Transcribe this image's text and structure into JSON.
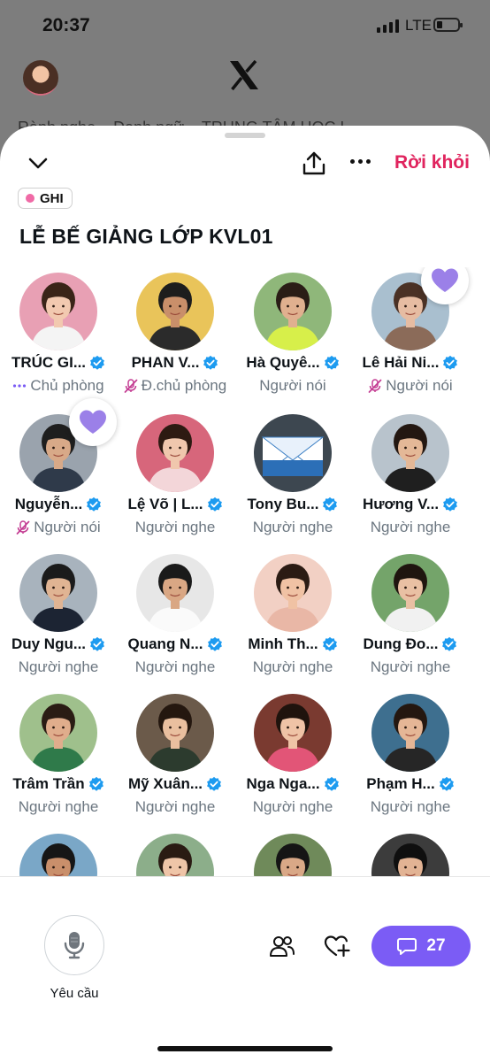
{
  "status": {
    "time": "20:37",
    "network": "LTE"
  },
  "background_text": "Rành nghe... Danh ngữ... TRUNG TÂM HỌC L...",
  "header": {
    "leave_label": "Rời khỏi"
  },
  "recording_badge": "GHI",
  "space_title": "LỄ BẾ GIẢNG LỚP KVL01",
  "members": [
    {
      "name": "TRÚC GI...",
      "role": "Chủ phòng",
      "role_icon": "speaking-dots-icon",
      "heart": false,
      "avatar_bg": "#e8a0b4",
      "skin": "#f2c9b0",
      "hair": "#3a2418",
      "shirt": "#f4f4f4"
    },
    {
      "name": "PHAN V...",
      "role": "Đ.chủ phòng",
      "role_icon": "mic-muted-icon",
      "heart": false,
      "avatar_bg": "#e9c45a",
      "skin": "#c98f6a",
      "hair": "#1d1d1d",
      "shirt": "#2b2b2b"
    },
    {
      "name": "Hà Quyê...",
      "role": "Người nói",
      "role_icon": "",
      "heart": false,
      "avatar_bg": "#8fb77a",
      "skin": "#e0b08f",
      "hair": "#2a1d16",
      "shirt": "#d7ef4a"
    },
    {
      "name": "Lê Hải Ni...",
      "role": "Người nói",
      "role_icon": "mic-muted-icon",
      "heart": true,
      "avatar_bg": "#a9bfcf",
      "skin": "#e6bca2",
      "hair": "#4a3125",
      "shirt": "#8b6b59"
    },
    {
      "name": "Nguyễn...",
      "role": "Người nói",
      "role_icon": "mic-muted-icon",
      "heart": true,
      "avatar_bg": "#9aa3ad",
      "skin": "#d8a988",
      "hair": "#1e1e1e",
      "shirt": "#2f3a4a"
    },
    {
      "name": "Lệ Võ | L...",
      "role": "Người nghe",
      "role_icon": "",
      "heart": false,
      "avatar_bg": "#d7667b",
      "skin": "#f0c7ad",
      "hair": "#2d1a12",
      "shirt": "#f3d6d9"
    },
    {
      "name": "Tony Bu...",
      "role": "Người nghe",
      "role_icon": "",
      "heart": false,
      "avatar_bg": "#3d4750",
      "skin": "",
      "hair": "",
      "shirt": ""
    },
    {
      "name": "Hương V...",
      "role": "Người nghe",
      "role_icon": "",
      "heart": false,
      "avatar_bg": "#b8c3cc",
      "skin": "#e4b897",
      "hair": "#231711",
      "shirt": "#1f1f1f"
    },
    {
      "name": "Duy Ngu...",
      "role": "Người nghe",
      "role_icon": "",
      "heart": false,
      "avatar_bg": "#a8b3bd",
      "skin": "#e0b493",
      "hair": "#1b1b1b",
      "shirt": "#1c2433"
    },
    {
      "name": "Quang N...",
      "role": "Người nghe",
      "role_icon": "",
      "heart": false,
      "avatar_bg": "#e7e7e7",
      "skin": "#d9a784",
      "hair": "#1a1a1a",
      "shirt": "#fafafa"
    },
    {
      "name": "Minh Th...",
      "role": "Người nghe",
      "role_icon": "",
      "heart": false,
      "avatar_bg": "#f2d0c4",
      "skin": "#f0c2a4",
      "hair": "#2b1b13",
      "shirt": "#e9b7a6"
    },
    {
      "name": "Dung Đo...",
      "role": "Người nghe",
      "role_icon": "",
      "heart": false,
      "avatar_bg": "#74a46a",
      "skin": "#e9c0a3",
      "hair": "#1f150f",
      "shirt": "#f1f1f1"
    },
    {
      "name": "Trâm Trần",
      "role": "Người nghe",
      "role_icon": "",
      "heart": false,
      "avatar_bg": "#9fc08c",
      "skin": "#e0ad8c",
      "hair": "#2a1c14",
      "shirt": "#2f7a4a"
    },
    {
      "name": "Mỹ Xuân...",
      "role": "Người nghe",
      "role_icon": "",
      "heart": false,
      "avatar_bg": "#6b5a4a",
      "skin": "#e9bf9f",
      "hair": "#24170f",
      "shirt": "#2c3b2e"
    },
    {
      "name": "Nga Nga...",
      "role": "Người nghe",
      "role_icon": "",
      "heart": false,
      "avatar_bg": "#7a3a30",
      "skin": "#efc3a6",
      "hair": "#1f130d",
      "shirt": "#e25577"
    },
    {
      "name": "Phạm H...",
      "role": "Người nghe",
      "role_icon": "",
      "heart": false,
      "avatar_bg": "#3e6f8f",
      "skin": "#e5b696",
      "hair": "#241710",
      "shirt": "#262626"
    },
    {
      "name": "",
      "role": "",
      "role_icon": "",
      "heart": false,
      "avatar_bg": "#7aa7c7",
      "skin": "#c98f6b",
      "hair": "#161616",
      "shirt": "#2b4d7a"
    },
    {
      "name": "",
      "role": "",
      "role_icon": "",
      "heart": false,
      "avatar_bg": "#8cae8a",
      "skin": "#efc5a8",
      "hair": "#2a1b13",
      "shirt": "#dfe4e8"
    },
    {
      "name": "",
      "role": "",
      "role_icon": "",
      "heart": false,
      "avatar_bg": "#6f8a5a",
      "skin": "#d9a887",
      "hair": "#151515",
      "shirt": "#3a3a3a"
    },
    {
      "name": "",
      "role": "",
      "role_icon": "",
      "heart": false,
      "avatar_bg": "#3c3c3c",
      "skin": "#e2b394",
      "hair": "#0f0f0f",
      "shirt": "#111111"
    }
  ],
  "bottom_bar": {
    "request_label": "Yêu cầu",
    "comment_count": "27"
  },
  "colors": {
    "accent": "#7b5cf5",
    "leave": "#e0245e",
    "verified": "#1d9bf0",
    "heart": "#9b80e8",
    "muted_role": "#6b7680"
  }
}
